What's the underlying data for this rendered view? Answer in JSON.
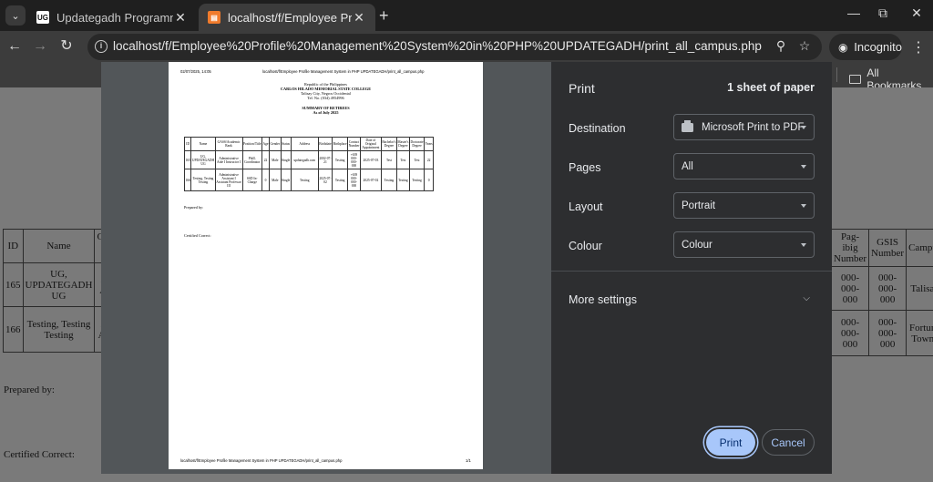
{
  "browser": {
    "tabs": [
      {
        "title": "Updategadh Programming - Up",
        "favicon": "UG",
        "active": false
      },
      {
        "title": "localhost/f/Employee Profile Ma",
        "favicon": "xampp",
        "active": true
      }
    ],
    "url": "localhost/f/Employee%20Profile%20Management%20System%20in%20PHP%20UPDATEGADH/print_all_campus.php",
    "incognito_label": "Incognito",
    "bookmarks_label": "All Bookmarks"
  },
  "background_page": {
    "left_headers": [
      "ID",
      "Name",
      "GAS"
    ],
    "left_rows": [
      {
        "id": "165",
        "name": "UG, UPDATEGADH UG",
        "gas": "Ad Aid"
      },
      {
        "id": "166",
        "name": "Testing, Testing Testing",
        "gas": "Ad A Pr"
      }
    ],
    "right_headers": [
      "Pag-ibig Number",
      "GSIS Number",
      "Campus"
    ],
    "right_rows": [
      {
        "pagibig": "000-000-000",
        "gsis": "000-000-000",
        "campus": "Talisay"
      },
      {
        "pagibig": "000-000-000",
        "gsis": "000-000-000",
        "campus": "Fortune Towne"
      }
    ],
    "prepared_by": "Prepared by:",
    "certified_correct": "Certified Correct:"
  },
  "paper": {
    "header_date": "02/07/2025, 14:05",
    "header_url": "localhost/f/Employee Profile Management System in PHP UPDATEGADH/print_all_campus.php",
    "republic": "Republic of the Philippines",
    "college": "CARLOS HILADO MEMORIAL STATE COLLEGE",
    "address": "Talisay City, Negros Occidental",
    "tel": "Tel. No. (034) 4954996",
    "summary": "SUMMARY OF RETIREES",
    "as_of": "As of July 2025",
    "table_headers": [
      "ID",
      "Name",
      "GASS/Academic Rank",
      "Position/Title",
      "Age",
      "Gender",
      "Status",
      "Address",
      "Birthdate",
      "Birthplace",
      "Contact Number",
      "Date of Original Appointment",
      "Bachelor's Degree",
      "Master's Degree",
      "Doctorate Degree",
      "Years"
    ],
    "table_rows": [
      [
        "165",
        "UG, UPDATEGADH UG",
        "Administrative Aide I Instructor I",
        "PhilL Coordinator",
        "22",
        "Male",
        "Single",
        "updategadh.com",
        "2002-07-21",
        "Testing",
        "+639 000-000-000",
        "2025-07-03",
        "Test",
        "Test",
        "Test",
        "22"
      ],
      [
        "166",
        "Testing, Testing Testing",
        "Administrative Assistant I Assistant Professor III",
        "SSD In-Charge",
        "0",
        "Male",
        "Single",
        "Testing",
        "2025-07-02",
        "Testing",
        "+639 000-000-000",
        "2025-07-02",
        "Testing",
        "Testing",
        "Testing",
        "0"
      ]
    ],
    "prepared_by": "Prepared by:",
    "certified_correct": "Certified Correct:",
    "footer_url": "localhost/f/Employee Profile Management System in PHP UPDATEGADH/print_all_campus.php",
    "page_number": "1/1"
  },
  "print_dialog": {
    "title": "Print",
    "sheets": "1 sheet of paper",
    "destination_label": "Destination",
    "destination_value": "Microsoft Print to PDF",
    "pages_label": "Pages",
    "pages_value": "All",
    "layout_label": "Layout",
    "layout_value": "Portrait",
    "colour_label": "Colour",
    "colour_value": "Colour",
    "more_settings": "More settings",
    "print_button": "Print",
    "cancel_button": "Cancel"
  }
}
